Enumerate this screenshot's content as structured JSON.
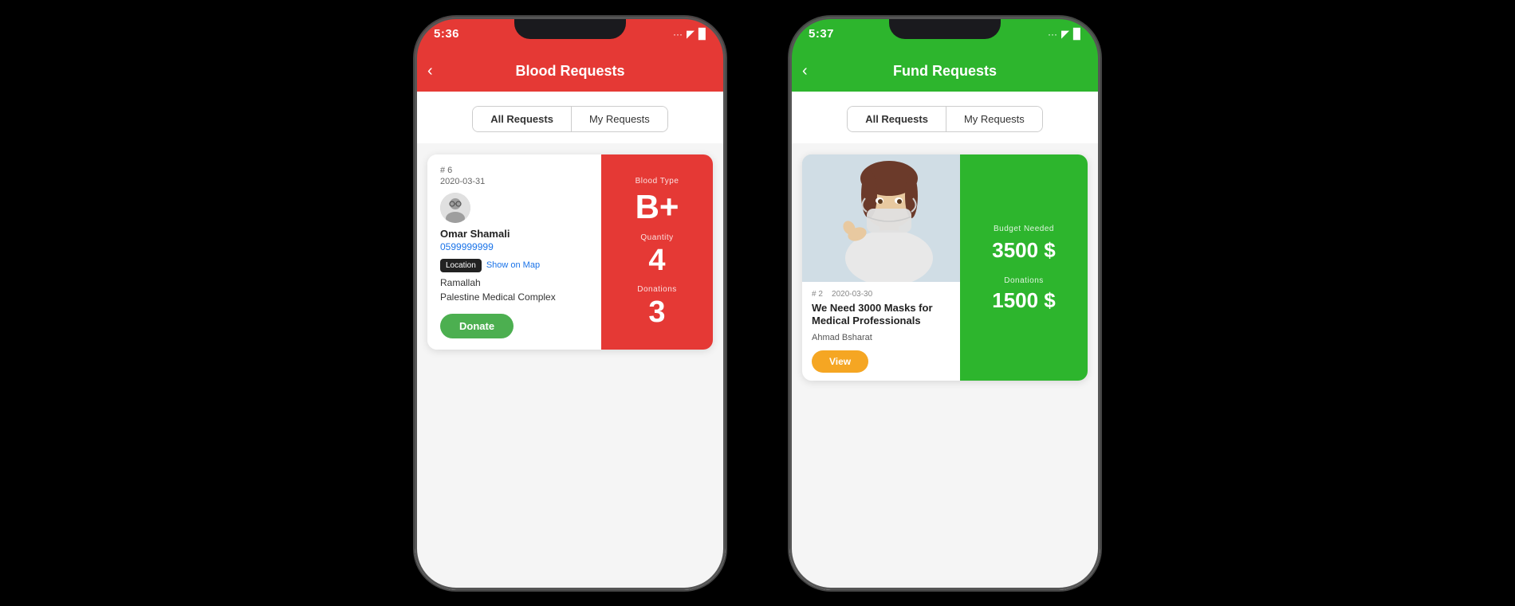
{
  "phone1": {
    "status_time": "5:36",
    "header_title": "Blood Requests",
    "tab_all": "All Requests",
    "tab_my": "My Requests",
    "card": {
      "number": "# 6",
      "date": "2020-03-31",
      "person_name": "Omar Shamali",
      "person_phone": "0599999999",
      "location_badge": "Location",
      "show_map": "Show on Map",
      "location": "Ramallah",
      "hospital": "Palestine Medical Complex",
      "donate_btn": "Donate",
      "blood_type_label": "Blood Type",
      "blood_type_value": "B+",
      "quantity_label": "Quantity",
      "quantity_value": "4",
      "donations_label": "Donations",
      "donations_value": "3"
    }
  },
  "phone2": {
    "status_time": "5:37",
    "header_title": "Fund Requests",
    "tab_all": "All Requests",
    "tab_my": "My Requests",
    "card": {
      "number": "# 2",
      "date": "2020-03-30",
      "title": "We Need 3000 Masks for Medical Professionals",
      "author": "Ahmad Bsharat",
      "view_btn": "View",
      "budget_label": "Budget Needed",
      "budget_value": "3500 $",
      "donations_label": "Donations",
      "donations_value": "1500 $"
    }
  }
}
